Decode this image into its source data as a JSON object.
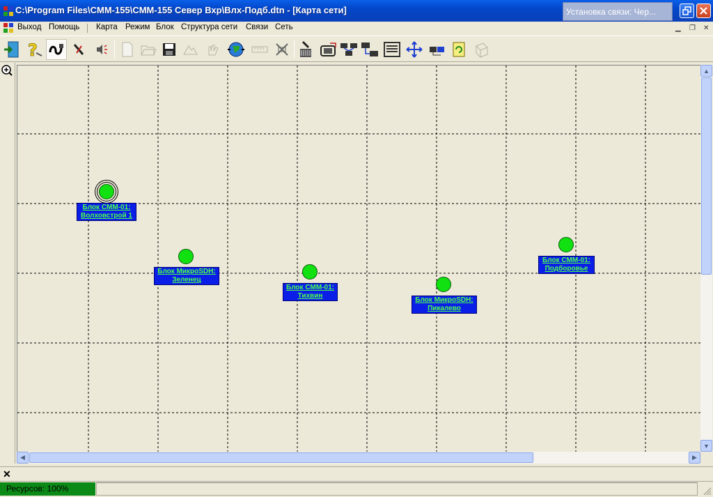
{
  "window": {
    "title": "C:\\Program Files\\CMM-155\\CMM-155 Север Вхр\\Влх-Подб.dtn - [Карта сети]",
    "popup_title": "Установка связи: Чер..."
  },
  "menu": {
    "items": [
      "Выход",
      "Помощь",
      "Карта",
      "Режим",
      "Блок",
      "Структура сети",
      "Связи",
      "Сеть"
    ]
  },
  "toolbar": {
    "buttons": [
      "exit-icon",
      "help-icon",
      "connect-icon",
      "tools-icon",
      "sound-icon",
      "new-file-icon",
      "open-file-icon",
      "save-icon",
      "image-icon",
      "hand-icon",
      "globe-icon",
      "ruler-icon",
      "disconnect-icon",
      "equipment-icon",
      "device-icon",
      "network-1-icon",
      "network-2-icon",
      "network-3-icon",
      "network-4-icon",
      "move-icon",
      "link-icon",
      "refresh-icon",
      "cube-icon"
    ]
  },
  "map": {
    "nodes": [
      {
        "line1": "Блок CMM-01:",
        "line2": "Волховстрой 1",
        "selected": true
      },
      {
        "line1": "Блок МикроSDH:",
        "line2": "Зеленец",
        "selected": false
      },
      {
        "line1": "Блок CMM-01:",
        "line2": "Тихвин",
        "selected": false
      },
      {
        "line1": "Блок МикроSDH:",
        "line2": "Пикалево",
        "selected": false
      },
      {
        "line1": "Блок CMM-01:",
        "line2": "Подборовье",
        "selected": false
      }
    ]
  },
  "status": {
    "resources": "Ресурсов: 100%"
  },
  "colors": {
    "titlebar": "#0347c9",
    "node_fill": "#11e011",
    "label_bg": "#0a1ee8",
    "label_text": "#4dff4d",
    "resource_bar": "#0c8a18"
  }
}
